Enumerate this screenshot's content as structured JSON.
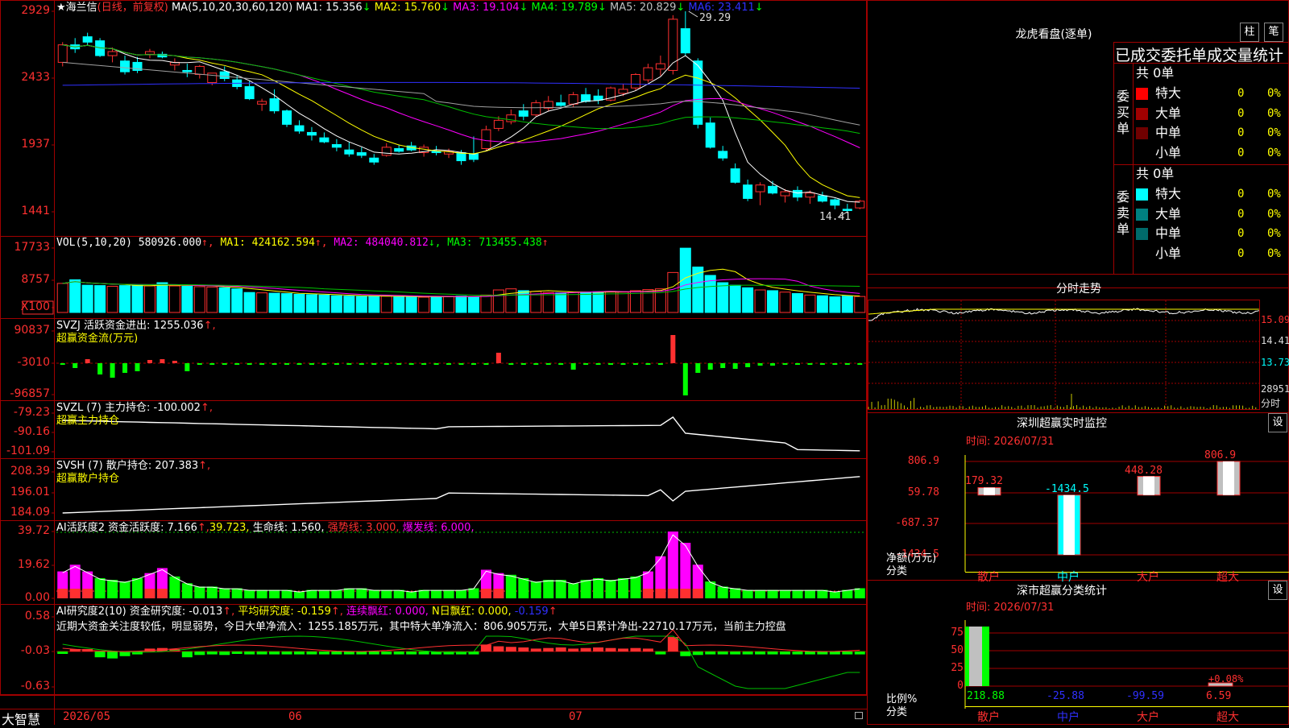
{
  "stock": {
    "name": "海兰信",
    "period": "(日线，前复权)",
    "ma_spec": "MA(5,10,20,30,60,120)",
    "ma": [
      {
        "label": "MA1:",
        "value": "15.356",
        "arrow": "↓",
        "color": "#ffffff"
      },
      {
        "label": "MA2:",
        "value": "15.760",
        "arrow": "↓",
        "color": "#ffff00"
      },
      {
        "label": "MA3:",
        "value": "19.104",
        "arrow": "↓",
        "color": "#ff00ff"
      },
      {
        "label": "MA4:",
        "value": "19.789",
        "arrow": "↓",
        "color": "#00ff00"
      },
      {
        "label": "MA5:",
        "value": "20.829",
        "arrow": "↓",
        "color": "#c0c0c0"
      },
      {
        "label": "MA6:",
        "value": "23.411",
        "arrow": "↓",
        "color": "#3030ff"
      }
    ],
    "high_label": "29.29",
    "low_label": "14.41"
  },
  "axes": {
    "price": [
      "2929",
      "2433",
      "1937",
      "1441"
    ],
    "vol": [
      "17733",
      "8757",
      "X100"
    ],
    "svzj": [
      "90837",
      "-3010",
      "-96857"
    ],
    "svzl": [
      "-79.23",
      "-90.16",
      "-101.09"
    ],
    "svsh": [
      "208.39",
      "196.01",
      "184.09"
    ],
    "ai1": [
      "39.72",
      "19.62",
      "0.00"
    ],
    "ai2": [
      "0.58",
      "-0.03",
      "-0.63"
    ]
  },
  "indicators": {
    "vol": {
      "spec": "VOL(5,10,20)",
      "value": "580926.000",
      "ma1": "MA1: 424162.594",
      "ma2": "MA2: 484040.812",
      "ma3": "MA3: 713455.438"
    },
    "svzj": {
      "spec": "SVZJ",
      "label": "活跃资金进出: 1255.036",
      "sub": "超赢资金流(万元)"
    },
    "svzl": {
      "spec": "SVZL (7)",
      "label": "主力持仓: -100.002",
      "sub": "超赢主力持仓"
    },
    "svsh": {
      "spec": "SVSH (7)",
      "label": "散户持仓: 207.383",
      "sub": "超赢散户持仓"
    },
    "ai1": {
      "spec": "AI活跃度2",
      "label": "资金活跃度: 7.166",
      "v2": "39.723",
      "life": "生命线: 1.560,",
      "strong": "强势线: 3.000,",
      "burst": "爆发线: 6.000,"
    },
    "ai2": {
      "spec": "AI研究度2(10)",
      "label": "资金研究度: -0.013",
      "avg": "平均研究度: -0.159",
      "red": "连续飘红: 0.000,",
      "nred": "N日飘红: 0.000,",
      "tail": "-0.159"
    },
    "note": "近期大资金关注度较低，明显弱势，今日大单净流入：1255.185万元，其中特大单净流入：806.905万元，大单5日累计净出-22710.17万元，当前主力控盘"
  },
  "bottom": {
    "app": "大智慧",
    "dates": [
      "2026/05",
      "06",
      "07"
    ]
  },
  "right": {
    "lhb": {
      "title": "龙虎看盘(逐单)",
      "btn1": "柱",
      "btn2": "笔",
      "header": "已成交委托单成交量统计",
      "buy": {
        "side": "委买单",
        "total": "共 0单",
        "rows": [
          {
            "label": "特大",
            "v": "0",
            "p": "0%",
            "color": "#ff0000"
          },
          {
            "label": "大单",
            "v": "0",
            "p": "0%",
            "color": "#a00000"
          },
          {
            "label": "中单",
            "v": "0",
            "p": "0%",
            "color": "#700000"
          },
          {
            "label": "小单",
            "v": "0",
            "p": "0%",
            "color": "#000000"
          }
        ]
      },
      "sell": {
        "side": "委卖单",
        "total": "共 0单",
        "rows": [
          {
            "label": "特大",
            "v": "0",
            "p": "0%",
            "color": "#00ffff"
          },
          {
            "label": "大单",
            "v": "0",
            "p": "0%",
            "color": "#008080"
          },
          {
            "label": "中单",
            "v": "0",
            "p": "0%",
            "color": "#006a6a"
          },
          {
            "label": "小单",
            "v": "0",
            "p": "0%",
            "color": "#000000"
          }
        ]
      }
    },
    "fenshi": {
      "title": "分时走势",
      "axis": [
        "15.09",
        "14.41",
        "13.73",
        "28951",
        "分时"
      ]
    },
    "monitor": {
      "title": "深圳超赢实时监控",
      "btn": "设",
      "time": "时间: 2026/07/31",
      "axis": [
        "806.9",
        "59.78",
        "-687.37",
        "-1434.5"
      ],
      "ylabel": "净额(万元)",
      "xlabel": "分类",
      "bars": [
        {
          "cat": "散户",
          "value": 179.32,
          "label": "179.32"
        },
        {
          "cat": "中户",
          "value": -1434.5,
          "label": "-1434.5"
        },
        {
          "cat": "大户",
          "value": 448.28,
          "label": "448.28"
        },
        {
          "cat": "超大",
          "value": 806.9,
          "label": "806.9"
        }
      ]
    },
    "stats": {
      "title": "深市超赢分类统计",
      "btn": "设",
      "time": "时间: 2026/07/31",
      "axis": [
        "75",
        "50",
        "25",
        "0"
      ],
      "ylabel": "比例%",
      "xlabel": "分类",
      "cats": [
        {
          "cat": "散户",
          "value": "218.88"
        },
        {
          "cat": "中户",
          "value": "-25.88"
        },
        {
          "cat": "大户",
          "value": "-99.59"
        },
        {
          "cat": "超大",
          "value": "6.59"
        }
      ],
      "pct_label": "+0.08%"
    }
  },
  "candles": [
    [
      25.5,
      27.0,
      25.2,
      26.8
    ],
    [
      26.8,
      27.3,
      26.2,
      26.5
    ],
    [
      27.4,
      27.7,
      26.8,
      27.0
    ],
    [
      27.1,
      27.3,
      25.9,
      26.0
    ],
    [
      26.0,
      26.6,
      25.5,
      26.3
    ],
    [
      25.6,
      26.0,
      24.6,
      24.8
    ],
    [
      25.5,
      25.9,
      24.7,
      24.9
    ],
    [
      26.1,
      26.5,
      25.8,
      26.3
    ],
    [
      26.1,
      26.3,
      25.8,
      25.9
    ],
    [
      25.3,
      25.8,
      24.9,
      25.5
    ],
    [
      24.9,
      25.4,
      24.4,
      24.8
    ],
    [
      24.6,
      25.3,
      24.3,
      25.2
    ],
    [
      24.0,
      24.7,
      23.8,
      24.7
    ],
    [
      24.8,
      25.2,
      24.1,
      24.3
    ],
    [
      24.2,
      24.5,
      23.5,
      23.7
    ],
    [
      23.7,
      24.1,
      22.7,
      22.8
    ],
    [
      22.4,
      22.8,
      21.9,
      22.6
    ],
    [
      22.8,
      23.5,
      21.7,
      21.9
    ],
    [
      21.9,
      22.0,
      20.7,
      20.9
    ],
    [
      20.8,
      21.2,
      20.2,
      20.4
    ],
    [
      20.3,
      20.7,
      19.7,
      20.1
    ],
    [
      19.9,
      20.3,
      19.5,
      19.6
    ],
    [
      19.4,
      19.8,
      18.9,
      19.2
    ],
    [
      19.0,
      19.6,
      18.5,
      18.7
    ],
    [
      18.8,
      19.2,
      18.4,
      18.6
    ],
    [
      18.4,
      18.7,
      17.9,
      18.1
    ],
    [
      18.6,
      19.5,
      18.5,
      19.2
    ],
    [
      19.1,
      19.4,
      18.8,
      18.9
    ],
    [
      19.3,
      19.6,
      18.9,
      19.0
    ],
    [
      18.8,
      19.4,
      18.5,
      19.2
    ],
    [
      18.9,
      19.3,
      18.6,
      18.8
    ],
    [
      18.7,
      19.1,
      18.4,
      18.9
    ],
    [
      18.8,
      19.0,
      17.9,
      18.2
    ],
    [
      18.7,
      20.0,
      18.1,
      18.3
    ],
    [
      19.1,
      20.8,
      18.9,
      20.5
    ],
    [
      20.6,
      21.5,
      20.4,
      21.2
    ],
    [
      21.1,
      22.0,
      20.9,
      21.6
    ],
    [
      21.9,
      22.4,
      21.2,
      21.5
    ],
    [
      21.6,
      22.7,
      21.5,
      22.5
    ],
    [
      22.1,
      23.0,
      21.9,
      22.6
    ],
    [
      22.5,
      23.1,
      22.2,
      22.3
    ],
    [
      22.4,
      23.3,
      22.2,
      23.1
    ],
    [
      23.1,
      23.6,
      22.5,
      22.6
    ],
    [
      23.0,
      23.5,
      22.4,
      22.7
    ],
    [
      22.7,
      23.7,
      22.6,
      23.6
    ],
    [
      23.2,
      23.9,
      23.0,
      23.5
    ],
    [
      23.6,
      24.7,
      23.4,
      24.6
    ],
    [
      24.2,
      25.4,
      24.0,
      25.1
    ],
    [
      25.0,
      26.0,
      24.5,
      25.4
    ],
    [
      24.9,
      29.0,
      24.6,
      28.7
    ],
    [
      28.0,
      29.29,
      26.0,
      26.2
    ],
    [
      25.6,
      25.8,
      20.6,
      20.9
    ],
    [
      21.0,
      21.4,
      19.1,
      19.2
    ],
    [
      18.9,
      19.3,
      18.2,
      18.4
    ],
    [
      17.6,
      18.0,
      16.5,
      16.6
    ],
    [
      16.4,
      16.8,
      15.2,
      15.4
    ],
    [
      15.9,
      16.6,
      14.9,
      16.4
    ],
    [
      16.3,
      16.7,
      15.7,
      15.8
    ],
    [
      15.6,
      16.1,
      15.1,
      15.9
    ],
    [
      16.0,
      16.3,
      15.2,
      15.5
    ],
    [
      15.5,
      16.0,
      15.0,
      15.8
    ],
    [
      15.6,
      15.9,
      15.1,
      15.2
    ],
    [
      15.3,
      15.4,
      14.6,
      14.9
    ],
    [
      14.6,
      15.0,
      14.41,
      14.5
    ],
    [
      14.7,
      15.3,
      14.6,
      15.2
    ]
  ]
}
